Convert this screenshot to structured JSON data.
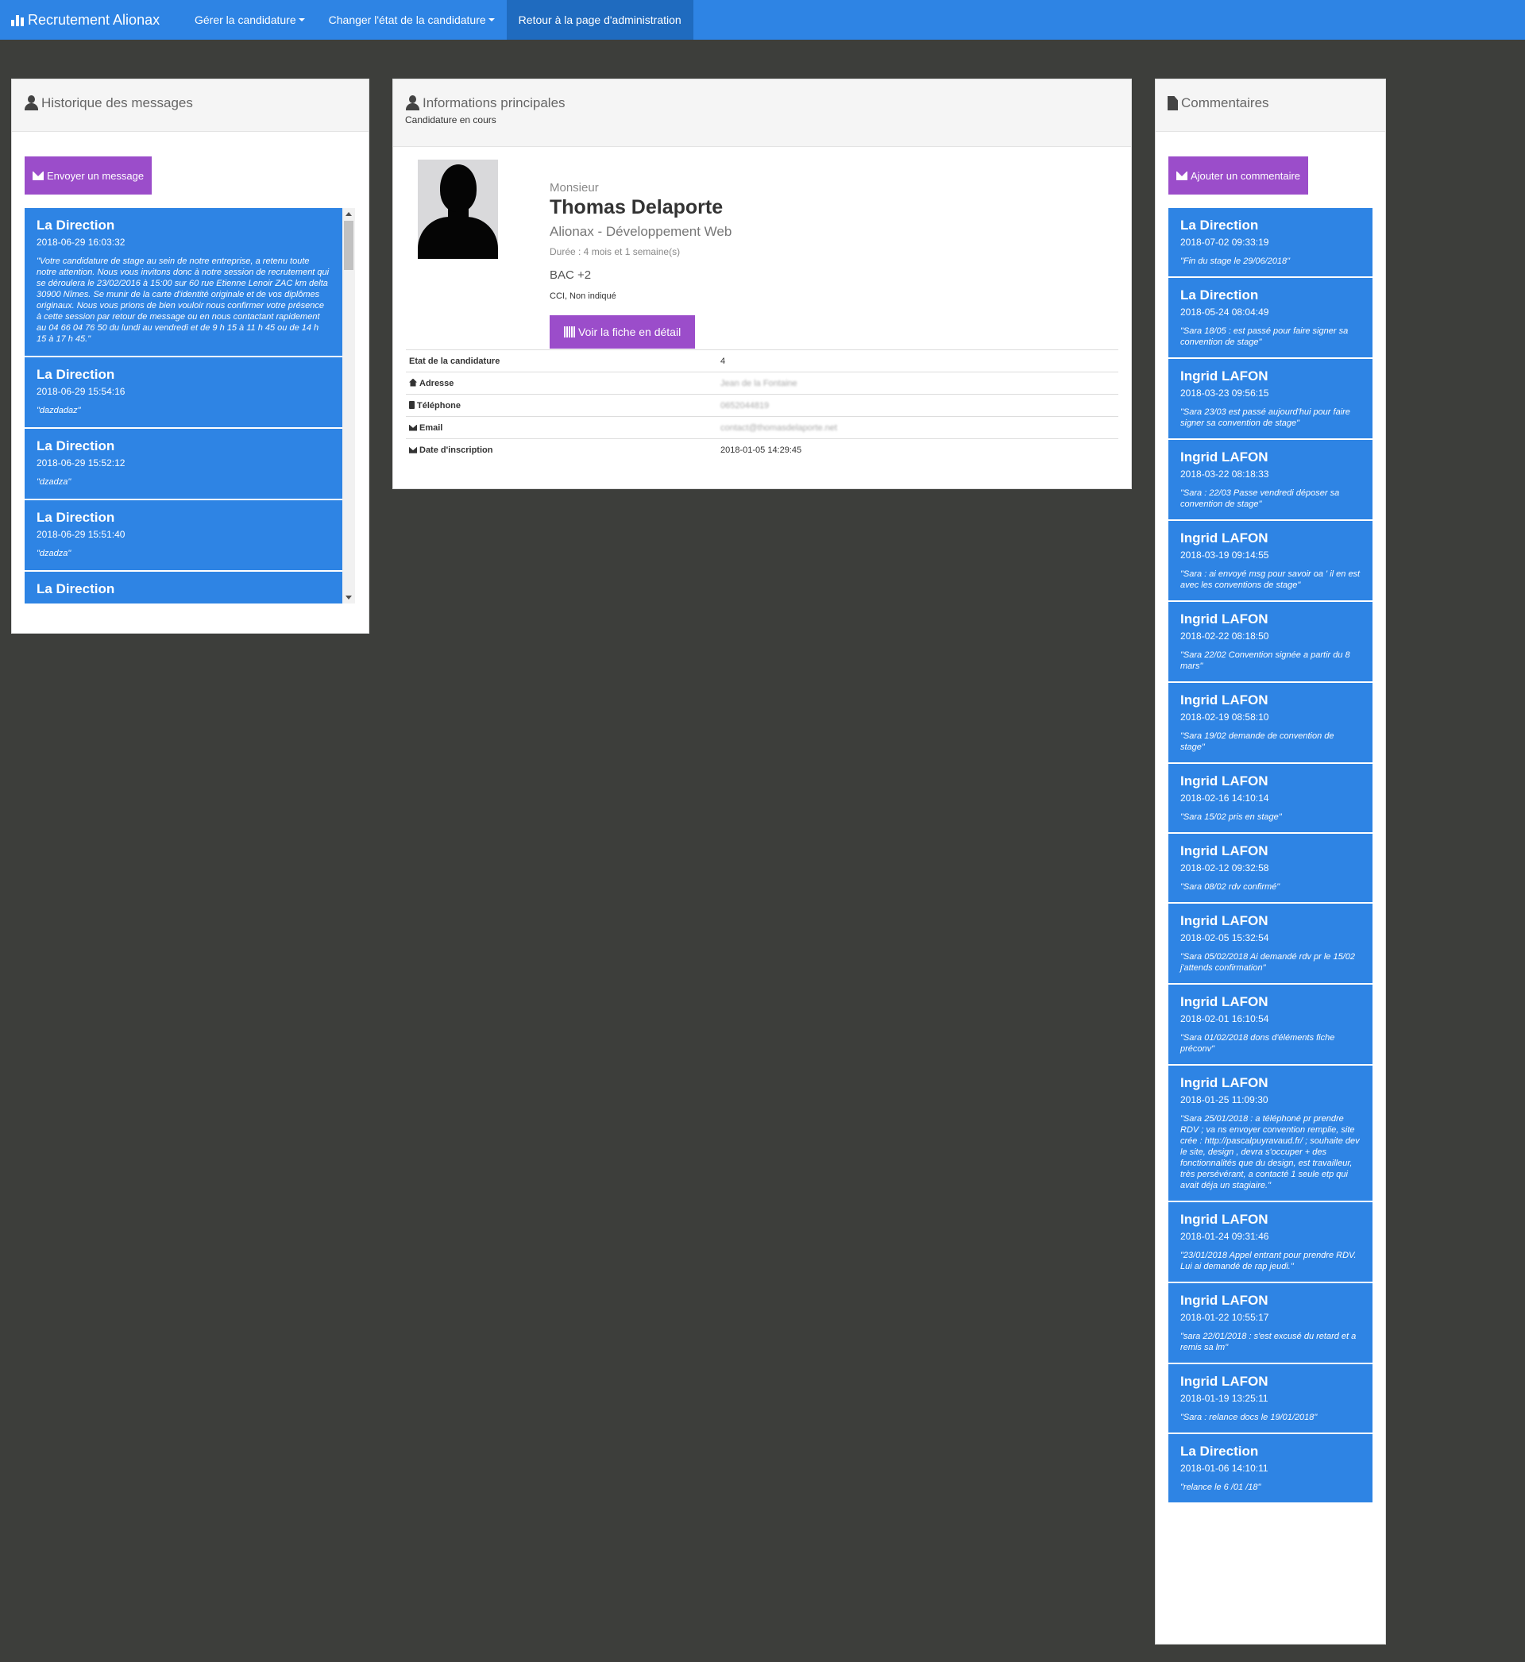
{
  "navbar": {
    "brand": "Recrutement Alionax",
    "items": [
      {
        "label": "Gérer la candidature"
      },
      {
        "label": "Changer l'état de la candidature"
      },
      {
        "label": "Retour à la page d'administration"
      }
    ]
  },
  "messages_panel": {
    "title": "Historique des messages",
    "button": "Envoyer un message",
    "messages": [
      {
        "author": "La Direction",
        "date": "2018-06-29 16:03:32",
        "text": "\"Votre candidature de stage au sein de notre entreprise, a retenu toute notre attention. Nous vous invitons donc à notre session de recrutement qui se déroulera le 23/02/2016 à 15:00 sur 60 rue Etienne Lenoir ZAC km delta 30900 Nîmes. Se munir de la carte d'identité originale et de vos diplômes originaux. Nous vous prions de bien vouloir nous confirmer votre présence à cette session par retour de message ou en nous contactant rapidement au 04 66 04 76 50 du lundi au vendredi et de 9 h 15 à 11 h 45 ou de 14 h 15 à 17 h 45.\""
      },
      {
        "author": "La Direction",
        "date": "2018-06-29 15:54:16",
        "text": "\"dazdadaz\""
      },
      {
        "author": "La Direction",
        "date": "2018-06-29 15:52:12",
        "text": "\"dzadza\""
      },
      {
        "author": "La Direction",
        "date": "2018-06-29 15:51:40",
        "text": "\"dzadza\""
      },
      {
        "author": "La Direction",
        "date": "",
        "text": ""
      }
    ]
  },
  "info_panel": {
    "title": "Informations principales",
    "subtitle": "Candidature en cours",
    "civility": "Monsieur",
    "name": "Thomas Delaporte",
    "company": "Alionax - Développement Web",
    "duration": "Durée : 4 mois et 1 semaine(s)",
    "level": "BAC +2",
    "origin": "CCI, Non indiqué",
    "button": "Voir la fiche en détail",
    "details": [
      {
        "key": "Etat de la candidature",
        "value": "4",
        "icon": "none",
        "blurred": false
      },
      {
        "key": "Adresse",
        "value": "Jean de la Fontaine",
        "icon": "home-icon",
        "blurred": true
      },
      {
        "key": "Téléphone",
        "value": "0652044819",
        "icon": "phone-icon",
        "blurred": true
      },
      {
        "key": "Email",
        "value": "contact@thomasdelaporte.net",
        "icon": "envelope-icon",
        "blurred": true
      },
      {
        "key": "Date d'inscription",
        "value": "2018-01-05 14:29:45",
        "icon": "envelope-icon",
        "blurred": false
      }
    ]
  },
  "comments_panel": {
    "title": "Commentaires",
    "button": "Ajouter un commentaire",
    "comments": [
      {
        "author": "La Direction",
        "date": "2018-07-02 09:33:19",
        "text": "\"Fin du stage le 29/06/2018\""
      },
      {
        "author": "La Direction",
        "date": "2018-05-24 08:04:49",
        "text": "\"Sara 18/05 : est passé pour faire signer sa convention de stage\""
      },
      {
        "author": "Ingrid LAFON",
        "date": "2018-03-23 09:56:15",
        "text": "\"Sara 23/03 est passé aujourd'hui pour faire signer sa convention de stage\""
      },
      {
        "author": "Ingrid LAFON",
        "date": "2018-03-22 08:18:33",
        "text": "\"Sara : 22/03 Passe vendredi déposer sa convention de stage\""
      },
      {
        "author": "Ingrid LAFON",
        "date": "2018-03-19 09:14:55",
        "text": "\"Sara : ai envoyé msg pour savoir oa ' il en est avec les conventions de stage\""
      },
      {
        "author": "Ingrid LAFON",
        "date": "2018-02-22 08:18:50",
        "text": "\"Sara 22/02 Convention signée a  partir du 8 mars\""
      },
      {
        "author": "Ingrid LAFON",
        "date": "2018-02-19 08:58:10",
        "text": "\"Sara 19/02 demande de convention de stage\""
      },
      {
        "author": "Ingrid LAFON",
        "date": "2018-02-16 14:10:14",
        "text": "\"Sara 15/02 pris en stage\""
      },
      {
        "author": "Ingrid LAFON",
        "date": "2018-02-12 09:32:58",
        "text": "\"Sara 08/02 rdv confirmé\""
      },
      {
        "author": "Ingrid LAFON",
        "date": "2018-02-05 15:32:54",
        "text": "\"Sara 05/02/2018 Ai demandé rdv pr le 15/02 j'attends confirmation\""
      },
      {
        "author": "Ingrid LAFON",
        "date": "2018-02-01 16:10:54",
        "text": "\"Sara 01/02/2018 dons d'éléments fiche préconv\""
      },
      {
        "author": "Ingrid LAFON",
        "date": "2018-01-25 11:09:30",
        "text": "\"Sara 25/01/2018 : a téléphoné pr prendre RDV ; va ns envoyer convention remplie, site crée : http://pascalpuyravaud.fr/ ; souhaite dev le site, design , devra s'occuper + des fonctionnalités que du design, est travailleur, très persévérant, a contacté 1 seule etp qui avait déja  un stagiaire.\""
      },
      {
        "author": "Ingrid LAFON",
        "date": "2018-01-24 09:31:46",
        "text": "\"23/01/2018 Appel entrant pour prendre RDV. Lui ai demandé de rap jeudi.\""
      },
      {
        "author": "Ingrid LAFON",
        "date": "2018-01-22 10:55:17",
        "text": "\"sara 22/01/2018 : s'est excusé du retard et a remis sa lm\""
      },
      {
        "author": "Ingrid LAFON",
        "date": "2018-01-19 13:25:11",
        "text": "\"Sara : relance docs le 19/01/2018\""
      },
      {
        "author": "La Direction",
        "date": "2018-01-06 14:10:11",
        "text": "\"relance le 6 /01 /18\""
      }
    ]
  }
}
